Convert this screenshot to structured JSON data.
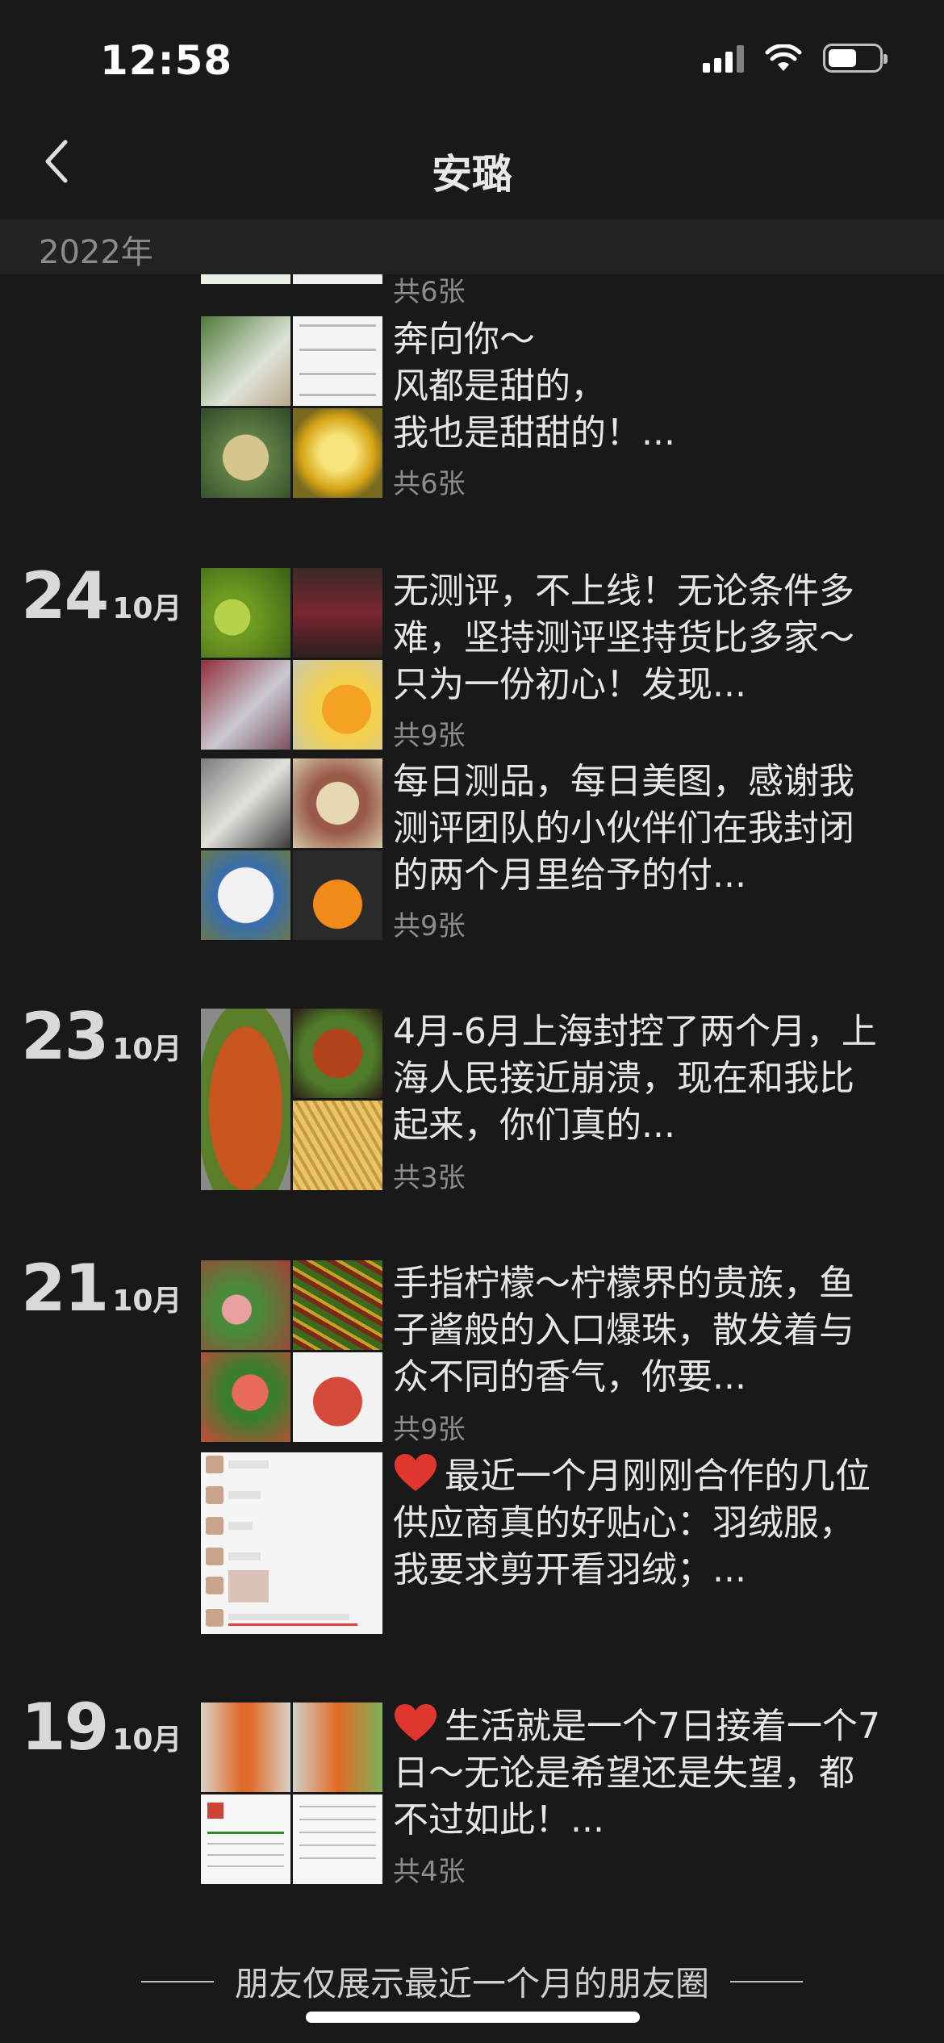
{
  "status_bar": {
    "time": "12:58"
  },
  "nav": {
    "title": "安璐"
  },
  "year": "2022年",
  "posts": [
    {
      "count": "共6张"
    },
    {
      "text": "奔向你～\n风都是甜的，\n我也是甜甜的！...",
      "count": "共6张"
    },
    {
      "day": "24",
      "month": "10月",
      "text": "无测评，不上线！无论条件多难，坚持测评坚持货比多家～只为一份初心！发现...",
      "count": "共9张"
    },
    {
      "text": "每日测品，每日美图，感谢我测评团队的小伙伴们在我封闭的两个月里给予的付...",
      "count": "共9张"
    },
    {
      "day": "23",
      "month": "10月",
      "text": "4月-6月上海封控了两个月，上海人民接近崩溃，现在和我比起来，你们真的...",
      "count": "共3张"
    },
    {
      "day": "21",
      "month": "10月",
      "text": "手指柠檬～柠檬界的贵族，鱼子酱般的入口爆珠，散发着与众不同的香气，你要...",
      "count": "共9张"
    },
    {
      "text": "最近一个月刚刚合作的几位供应商真的好贴心：羽绒服，我要求剪开看羽绒；...",
      "count": ""
    },
    {
      "day": "19",
      "month": "10月",
      "text": "生活就是一个7日接着一个7日～无论是希望还是失望，都不过如此！...",
      "count": "共4张"
    }
  ],
  "footer": {
    "note": "朋友仅展示最近一个月的朋友圈"
  },
  "colors": {
    "background": "#191919",
    "text": "#e6e6e6",
    "muted": "#8c8c8c",
    "heart": "#e0362e"
  }
}
